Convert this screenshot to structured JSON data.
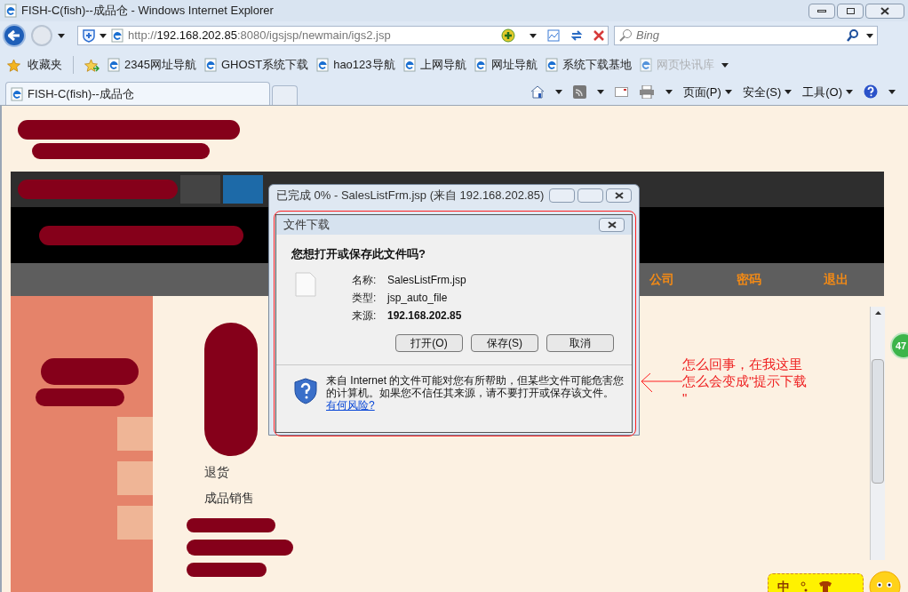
{
  "window": {
    "title": "FISH-C(fish)--成品仓 - Windows Internet Explorer"
  },
  "address_bar": {
    "scheme": "http://",
    "host": "192.168.202.85",
    "path": ":8080/igsjsp/newmain/igs2.jsp"
  },
  "search": {
    "placeholder": "Bing"
  },
  "favorites_bar": {
    "label": "收藏夹",
    "items": [
      {
        "label": "2345网址导航",
        "disabled": false
      },
      {
        "label": "GHOST系统下载",
        "disabled": false
      },
      {
        "label": "hao123导航",
        "disabled": false
      },
      {
        "label": "上网导航",
        "disabled": false
      },
      {
        "label": "网址导航",
        "disabled": false
      },
      {
        "label": "系统下载基地",
        "disabled": false
      },
      {
        "label": "网页快讯库",
        "disabled": true
      }
    ]
  },
  "tabs": [
    {
      "label": "FISH-C(fish)--成品仓",
      "selected": true
    }
  ],
  "command_bar": [
    "页面(P)",
    "安全(S)",
    "工具(O)"
  ],
  "page": {
    "nav_links": [
      "公司",
      "密码",
      "退出"
    ],
    "menu_items": [
      "退货",
      "成品销售"
    ],
    "side_badge": "47",
    "widget_glyph": "中"
  },
  "progress_window": {
    "title": "已完成 0% - SalesListFrm.jsp (来自 192.168.202.85)"
  },
  "download_dialog": {
    "title": "文件下载",
    "question": "您想打开或保存此文件吗?",
    "fields": [
      {
        "label": "名称:",
        "value": "SalesListFrm.jsp",
        "bold": false
      },
      {
        "label": "类型:",
        "value": "jsp_auto_file",
        "bold": false
      },
      {
        "label": "来源:",
        "value": "192.168.202.85",
        "bold": true
      }
    ],
    "buttons": [
      "打开(O)",
      "保存(S)",
      "取消"
    ],
    "warning": "来自 Internet 的文件可能对您有所帮助，但某些文件可能危害您的计算机。如果您不信任其来源，请不要打开或保存该文件。",
    "link": "有何风险?"
  },
  "annotation": {
    "lines": [
      "怎么回事，在我这里",
      "怎么会变成\"提示下载",
      "\""
    ]
  }
}
